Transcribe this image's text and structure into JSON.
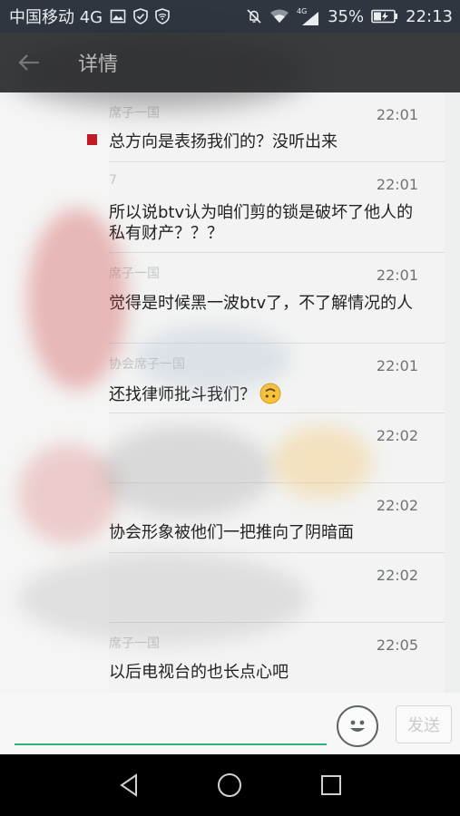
{
  "status_bar": {
    "carrier": "中国移动 4G",
    "battery": "35%",
    "time": "22:13",
    "network_label": "4G"
  },
  "header": {
    "title": "详情",
    "back_icon": "arrow-left-icon"
  },
  "messages": [
    {
      "sender": "席子一国",
      "time": "22:01",
      "text": "总方向是表扬我们的？没听出来"
    },
    {
      "sender": "7",
      "time": "22:01",
      "text": "所以说btv认为咱们剪的锁是破坏了他人的私有财产？？？"
    },
    {
      "sender": "席子一国",
      "time": "22:01",
      "text": "觉得是时候黑一波btv了，不了解情况的人"
    },
    {
      "sender": "协会席子一国",
      "time": "22:01",
      "text": "还找律师批斗我们？",
      "emoji": "upside-down-smile-icon"
    },
    {
      "sender": "",
      "time": "22:02",
      "text": ""
    },
    {
      "sender": "",
      "time": "22:02",
      "text": "协会形象被他们一把推向了阴暗面"
    },
    {
      "sender": "",
      "time": "22:02",
      "text": ""
    },
    {
      "sender": "席子一国",
      "time": "22:05",
      "text": "以后电视台的也长点心吧"
    }
  ],
  "input_bar": {
    "send_label": "发送",
    "emoji_icon": "smiley-face-icon"
  },
  "nav_bar": {
    "icons": [
      "back-triangle-icon",
      "home-circle-icon",
      "recents-square-icon"
    ]
  },
  "colors": {
    "status_bar_bg": "#2f3640",
    "header_bg": "#3a3b3d",
    "accent_green": "#2db37b",
    "message_bg": "#f2f3f2"
  }
}
